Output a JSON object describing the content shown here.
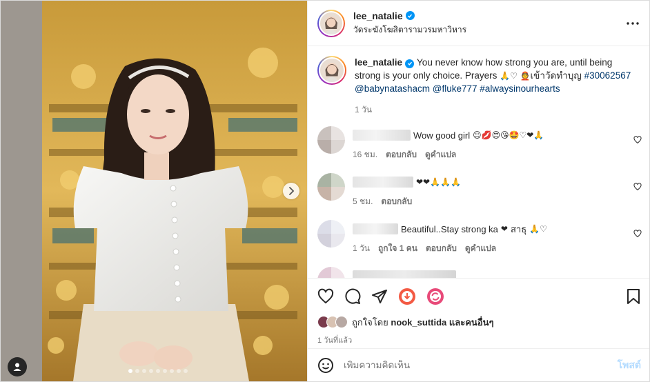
{
  "header": {
    "username": "lee_natalie",
    "location": "วัดระฆังโฆสิตารามวรมหาวิหาร"
  },
  "caption": {
    "username": "lee_natalie",
    "text": "You never know how strong you are, until being strong is your only choice. Prayers",
    "text_tail": "เข้าวัดทำบุญ",
    "hashtag1": "#30062567",
    "mention1": "@babynatashacm",
    "mention2": "@fluke777",
    "hashtag2": "#alwaysinourhearts",
    "age": "1 วัน"
  },
  "comments": [
    {
      "text": "Wow good girl",
      "age": "16 ชม.",
      "reply": "ตอบกลับ",
      "translate": "ดูคำแปล",
      "likes": ""
    },
    {
      "text": "",
      "age": "5 ชม.",
      "reply": "ตอบกลับ",
      "translate": "",
      "likes": ""
    },
    {
      "text": "Beautiful..Stay strong ka",
      "text_tail": "สาธุ",
      "age": "1 วัน",
      "likes": "ถูกใจ 1 คน",
      "reply": "ตอบกลับ",
      "translate": "ดูคำแปล"
    }
  ],
  "likes": {
    "prefix": "ถูกใจโดย",
    "user": "nook_suttida",
    "suffix": "และคนอื่นๆ"
  },
  "post_time": "1 วันที่แล้ว",
  "comment_box": {
    "placeholder": "เพิ่มความคิดเห็น",
    "post_label": "โพสต์"
  },
  "colors": {
    "accent_blue": "#0095f6",
    "link_blue": "#00376b",
    "muted_text": "#737373",
    "post_button_disabled": "#b3dbff"
  },
  "icons": [
    "verified-badge-icon",
    "more-options-icon",
    "heart-icon",
    "comment-icon",
    "share-icon",
    "save-icon",
    "emoji-icon",
    "next-arrow-icon",
    "tag-user-icon"
  ]
}
